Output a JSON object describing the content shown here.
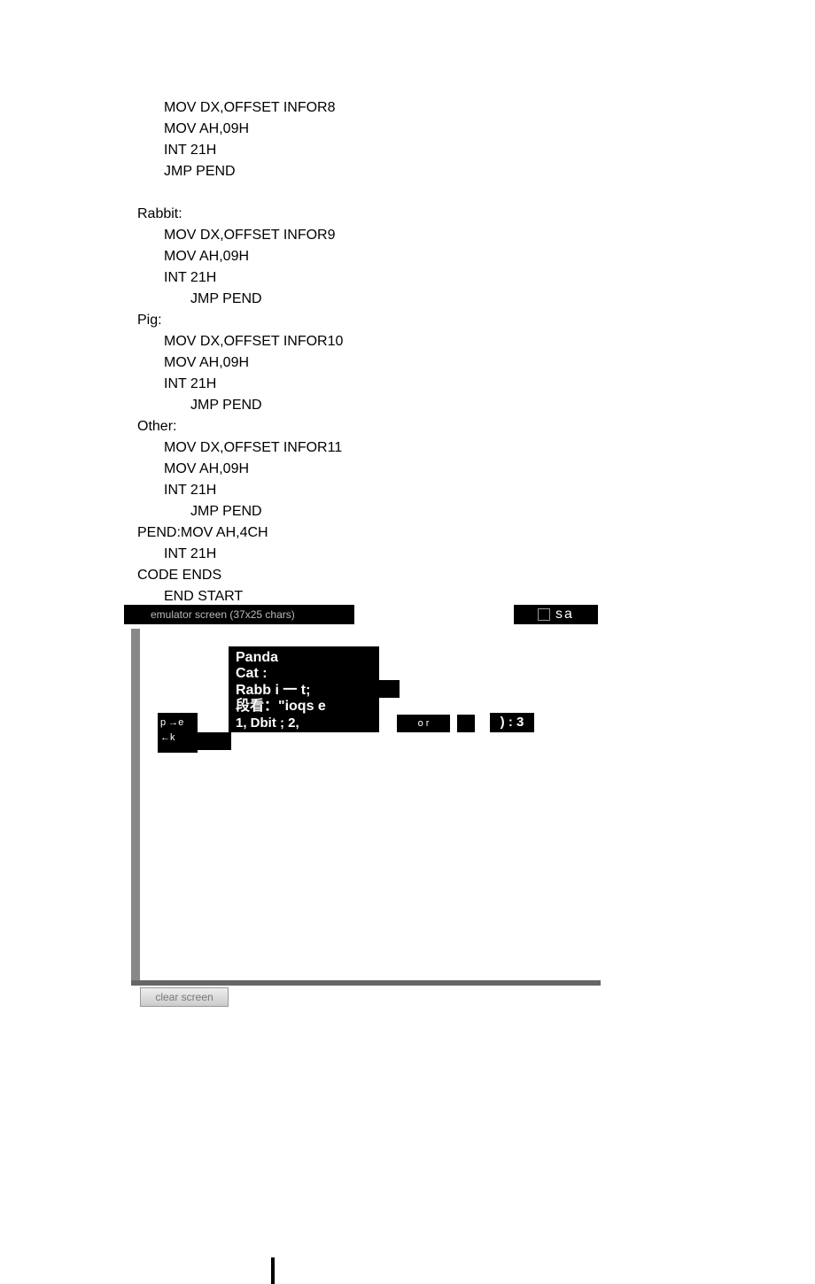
{
  "code": {
    "block1": [
      "MOV DX,OFFSET INFOR8",
      "MOV AH,09H",
      "INT 21H",
      "JMP PEND"
    ],
    "label_rabbit": "Rabbit:",
    "block2": [
      "MOV DX,OFFSET INFOR9",
      "MOV AH,09H",
      "INT 21H"
    ],
    "jmp2": "JMP PEND",
    "label_pig": "Pig:",
    "block3": [
      "MOV DX,OFFSET INFOR10",
      "MOV AH,09H",
      "INT 21H"
    ],
    "jmp3": "JMP PEND",
    "label_other": "Other:",
    "block4": [
      "MOV DX,OFFSET INFOR11",
      "MOV AH,09H",
      "INT 21H"
    ],
    "jmp4": "JMP PEND",
    "pend": "PEND:MOV AH,4CH",
    "pend2": "INT 21H",
    "code_ends": "CODE ENDS",
    "end_start": "END START"
  },
  "emulator": {
    "title": "emulator screen (37x25 chars)",
    "sa": "sa",
    "panda": "Panda",
    "cat": "Cat :",
    "rabbi": "Rabb i 一    t;",
    "duankan": "段看：\"ioqs e",
    "row5a": "1, Dbit ;        2,",
    "row5b": "o r",
    "row5c": ") : 3",
    "left_p": "p",
    "left_e": "e",
    "left_k": "k",
    "clear": "clear screen"
  }
}
